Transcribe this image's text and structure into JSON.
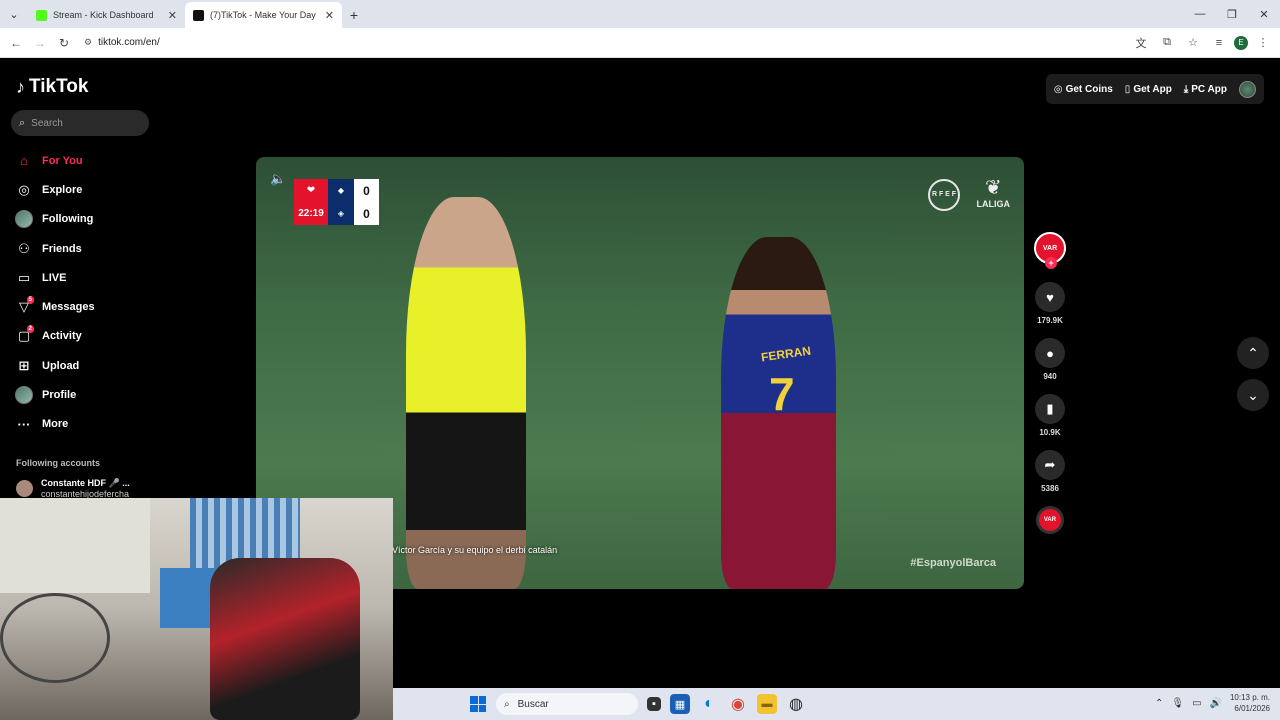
{
  "browser": {
    "tabs": [
      {
        "title": "Stream - Kick Dashboard",
        "favicon_color": "#53fc18"
      },
      {
        "title": "(7)TikTok - Make Your Day",
        "favicon_color": "#111111"
      }
    ],
    "url": "tiktok.com/en/",
    "profile_initial": "E"
  },
  "tiktok": {
    "brand": "TikTok",
    "search_placeholder": "Search",
    "nav": [
      {
        "label": "For You",
        "icon": "home-icon"
      },
      {
        "label": "Explore",
        "icon": "compass-icon"
      },
      {
        "label": "Following",
        "icon": "avatar-icon"
      },
      {
        "label": "Friends",
        "icon": "friends-icon"
      },
      {
        "label": "LIVE",
        "icon": "live-icon"
      },
      {
        "label": "Messages",
        "icon": "messages-icon",
        "badge": "5"
      },
      {
        "label": "Activity",
        "icon": "activity-icon",
        "badge": "2"
      },
      {
        "label": "Upload",
        "icon": "upload-icon"
      },
      {
        "label": "Profile",
        "icon": "profile-icon"
      },
      {
        "label": "More",
        "icon": "more-icon"
      }
    ],
    "following_header": "Following accounts",
    "following": [
      {
        "name": "Constante HDF 🎤 ...",
        "handle": "constantehijodefercha"
      }
    ],
    "top_actions": {
      "coins": "Get Coins",
      "app": "Get App",
      "pc_app": "PC App"
    },
    "accent": "#fe2c55"
  },
  "video": {
    "scoreboard": {
      "time": "22:19",
      "home_score": "0",
      "away_score": "0"
    },
    "rfef": "R F E F",
    "league": "LALIGA",
    "caption": "Víctor García y su equipo el derbi catalán",
    "hashtag": "#EspanyolBarca",
    "player_name": "FERRAN",
    "player_number": "7"
  },
  "actions": {
    "avatar_label": "VAR",
    "likes": "179.9K",
    "comments": "940",
    "saves": "10.9K",
    "shares": "5386",
    "music_label": "VAR"
  },
  "taskbar": {
    "search_label": "Buscar",
    "time": "10:13 p. m.",
    "date": "6/01/2026"
  }
}
